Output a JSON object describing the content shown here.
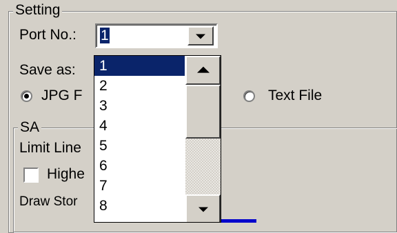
{
  "setting": {
    "legend": "Setting",
    "port_label": "Port No.:",
    "port_value": "1",
    "save_as_label": "Save as:",
    "radio_jpg_label": "JPG F",
    "radio_text_label": "Text File"
  },
  "sa": {
    "legend": "SA",
    "limit_line_label": "Limit Line",
    "higher_label": "Highe",
    "draw_label": "Draw Stor"
  },
  "dropdown": {
    "items": [
      "1",
      "2",
      "3",
      "4",
      "5",
      "6",
      "7",
      "8"
    ],
    "selected": "1"
  },
  "icons": {
    "combo_arrow": "chevron-down-icon",
    "scroll_up": "scroll-up-arrow-icon",
    "scroll_down": "scroll-down-arrow-icon"
  },
  "colors": {
    "window_bg": "#d4d0c8",
    "selection": "#0a246a",
    "accent_bar": "#0000cc"
  }
}
